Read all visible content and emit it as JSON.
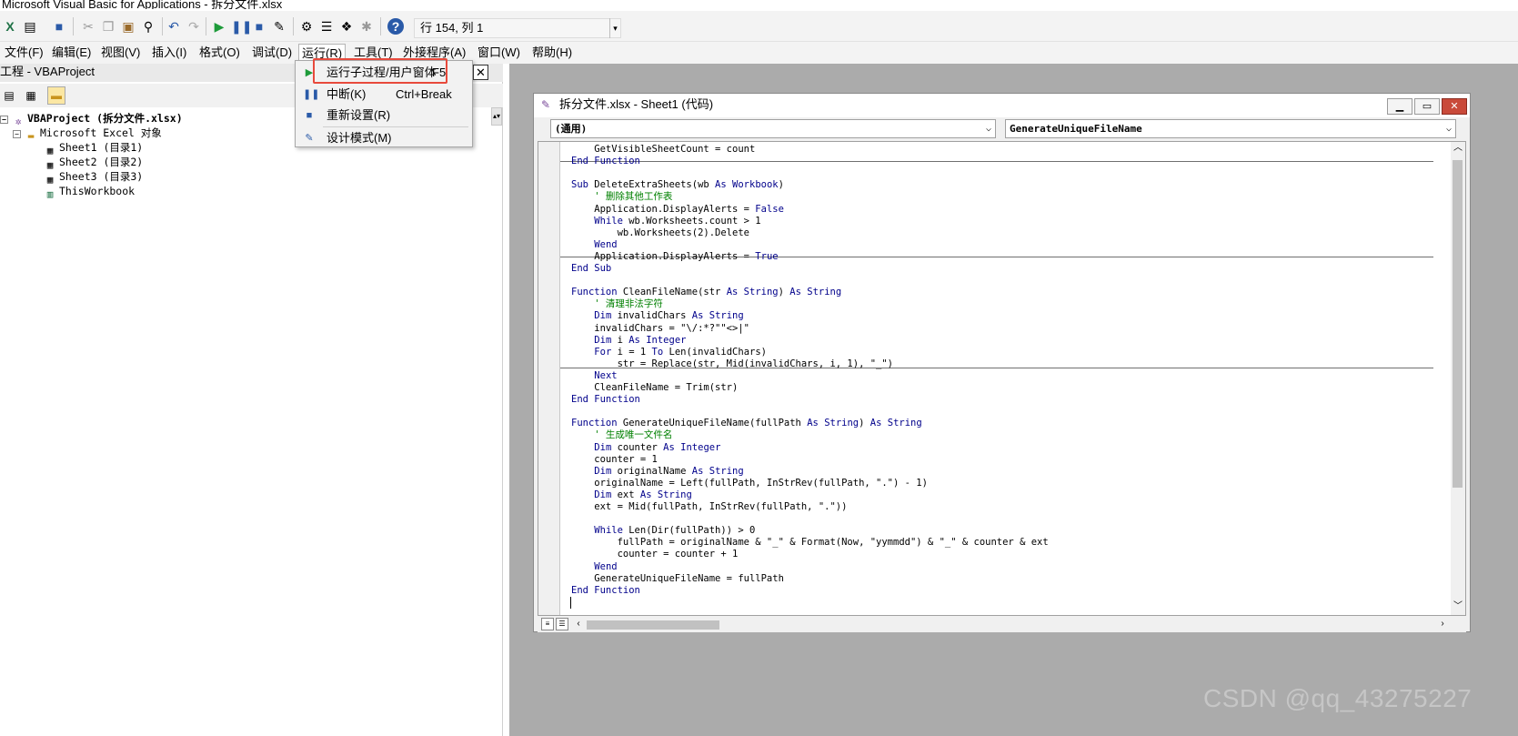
{
  "window": {
    "title": "Microsoft Visual Basic for Applications - 拆分文件.xlsx"
  },
  "toolbar": {
    "status": "行 154, 列 1",
    "icons": [
      "excel-icon",
      "insert-object-icon",
      "save-icon",
      "cut-icon",
      "copy-icon",
      "paste-icon",
      "find-icon",
      "undo-icon",
      "redo-icon",
      "run-icon",
      "break-icon",
      "reset-icon",
      "design-mode-icon",
      "project-explorer-icon",
      "properties-icon",
      "object-browser-icon",
      "toolbox-icon",
      "help-icon"
    ]
  },
  "menubar": {
    "items": [
      "文件(F)",
      "编辑(E)",
      "视图(V)",
      "插入(I)",
      "格式(O)",
      "调试(D)",
      "运行(R)",
      "工具(T)",
      "外接程序(A)",
      "窗口(W)",
      "帮助(H)"
    ]
  },
  "run_menu": {
    "items": [
      {
        "label": "运行子过程/用户窗体",
        "shortcut": "F5",
        "icon": "run-icon"
      },
      {
        "label": "中断(K)",
        "shortcut": "Ctrl+Break",
        "icon": "break-icon"
      },
      {
        "label": "重新设置(R)",
        "shortcut": "",
        "icon": "reset-icon"
      },
      {
        "label": "设计模式(M)",
        "shortcut": "",
        "icon": "design-mode-icon"
      }
    ],
    "highlight_color": "#e84a3c"
  },
  "project_panel": {
    "title": "工程 - VBAProject",
    "tree": [
      {
        "label": "VBAProject (拆分文件.xlsx)",
        "level": 0,
        "icon": "vba-project-icon"
      },
      {
        "label": "Microsoft Excel 对象",
        "level": 1,
        "icon": "folder-icon"
      },
      {
        "label": "Sheet1 (目录1)",
        "level": 2,
        "icon": "sheet-icon"
      },
      {
        "label": "Sheet2 (目录2)",
        "level": 2,
        "icon": "sheet-icon"
      },
      {
        "label": "Sheet3 (目录3)",
        "level": 2,
        "icon": "sheet-icon"
      },
      {
        "label": "ThisWorkbook",
        "level": 2,
        "icon": "workbook-icon"
      }
    ]
  },
  "code_window": {
    "title": "拆分文件.xlsx - Sheet1 (代码)",
    "object_combo": "(通用)",
    "procedure_combo": "GenerateUniqueFileName",
    "lines": [
      "    GetVisibleSheetCount = count",
      "End Function",
      "",
      "Sub DeleteExtraSheets(wb As Workbook)",
      "    ' 删除其他工作表",
      "    Application.DisplayAlerts = False",
      "    While wb.Worksheets.count > 1",
      "        wb.Worksheets(2).Delete",
      "    Wend",
      "    Application.DisplayAlerts = True",
      "End Sub",
      "",
      "Function CleanFileName(str As String) As String",
      "    ' 清理非法字符",
      "    Dim invalidChars As String",
      "    invalidChars = \"\\/:*?\"\"<>|\"",
      "    Dim i As Integer",
      "    For i = 1 To Len(invalidChars)",
      "        str = Replace(str, Mid(invalidChars, i, 1), \"_\")",
      "    Next",
      "    CleanFileName = Trim(str)",
      "End Function",
      "",
      "Function GenerateUniqueFileName(fullPath As String) As String",
      "    ' 生成唯一文件名",
      "    Dim counter As Integer",
      "    counter = 1",
      "    Dim originalName As String",
      "    originalName = Left(fullPath, InStrRev(fullPath, \".\") - 1)",
      "    Dim ext As String",
      "    ext = Mid(fullPath, InStrRev(fullPath, \".\"))",
      "",
      "    While Len(Dir(fullPath)) > 0",
      "        fullPath = originalName & \"_\" & Format(Now, \"yymmdd\") & \"_\" & counter & ext",
      "        counter = counter + 1",
      "    Wend",
      "    GenerateUniqueFileName = fullPath",
      "End Function"
    ]
  },
  "watermark": "CSDN @qq_43275227",
  "colors": {
    "keyword": "#00008b",
    "comment": "#008000",
    "mdi_background": "#ababab"
  }
}
